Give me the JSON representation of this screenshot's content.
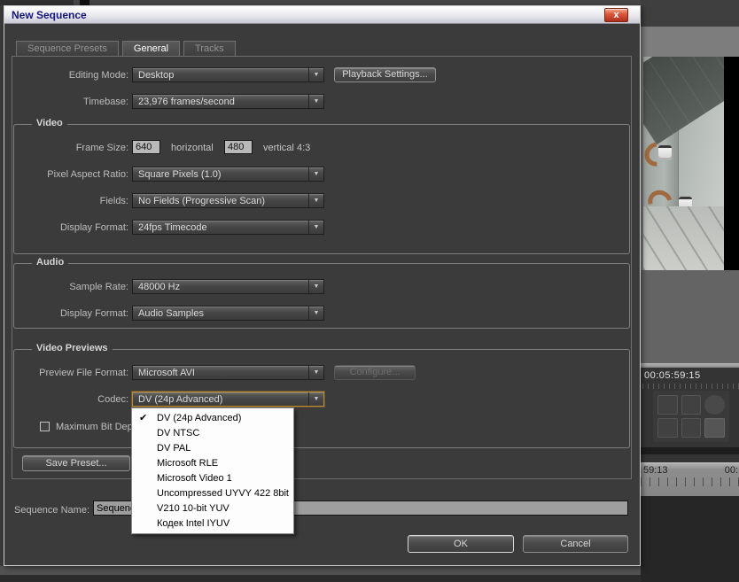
{
  "window": {
    "title": "New Sequence"
  },
  "icons": {
    "close": "x",
    "dropdown_arrow": "▼",
    "check": "✔"
  },
  "tabs": [
    {
      "label": "Sequence Presets"
    },
    {
      "label": "General"
    },
    {
      "label": "Tracks"
    }
  ],
  "general": {
    "editing_mode": {
      "label": "Editing Mode:",
      "value": "Desktop"
    },
    "playback_settings_button": "Playback Settings...",
    "timebase": {
      "label": "Timebase:",
      "value": "23,976 frames/second"
    }
  },
  "video": {
    "section_title": "Video",
    "frame_size": {
      "label": "Frame Size:",
      "horizontal_value": "640",
      "horizontal_label": "horizontal",
      "vertical_value": "480",
      "vertical_label": "vertical",
      "aspect": "4:3"
    },
    "pixel_aspect_ratio": {
      "label": "Pixel Aspect Ratio:",
      "value": "Square Pixels (1.0)"
    },
    "fields": {
      "label": "Fields:",
      "value": "No Fields (Progressive Scan)"
    },
    "display_format": {
      "label": "Display Format:",
      "value": "24fps Timecode"
    }
  },
  "audio": {
    "section_title": "Audio",
    "sample_rate": {
      "label": "Sample Rate:",
      "value": "48000 Hz"
    },
    "display_format": {
      "label": "Display Format:",
      "value": "Audio Samples"
    }
  },
  "video_previews": {
    "section_title": "Video Previews",
    "preview_file_format": {
      "label": "Preview File Format:",
      "value": "Microsoft AVI"
    },
    "configure_button": "Configure...",
    "codec": {
      "label": "Codec:",
      "value": "DV (24p Advanced)"
    },
    "maximum_bit_depth_label": "Maximum Bit Depth"
  },
  "codec_dropdown": {
    "selected_index": 0,
    "items": [
      "DV (24p Advanced)",
      "DV NTSC",
      "DV PAL",
      "Microsoft RLE",
      "Microsoft Video 1",
      "Uncompressed UYVY 422 8bit",
      "V210 10-bit YUV",
      "Кодек Intel IYUV"
    ]
  },
  "footer": {
    "save_preset_button": "Save Preset...",
    "sequence_name": {
      "label": "Sequence Name:",
      "value": "Sequence 01"
    },
    "ok_button": "OK",
    "cancel_button": "Cancel"
  },
  "background_app": {
    "program_monitor_timecode": "00:05:59:15",
    "timeline_label_left": "59:13",
    "timeline_label_right": "00:"
  },
  "colors": {
    "dialog_body": "#3b3b3b",
    "focus_border": "#c08a2e",
    "popup_bg": "#fdfdfd",
    "close_button_red": "#c23a26",
    "title_text_navy": "#15157d"
  }
}
